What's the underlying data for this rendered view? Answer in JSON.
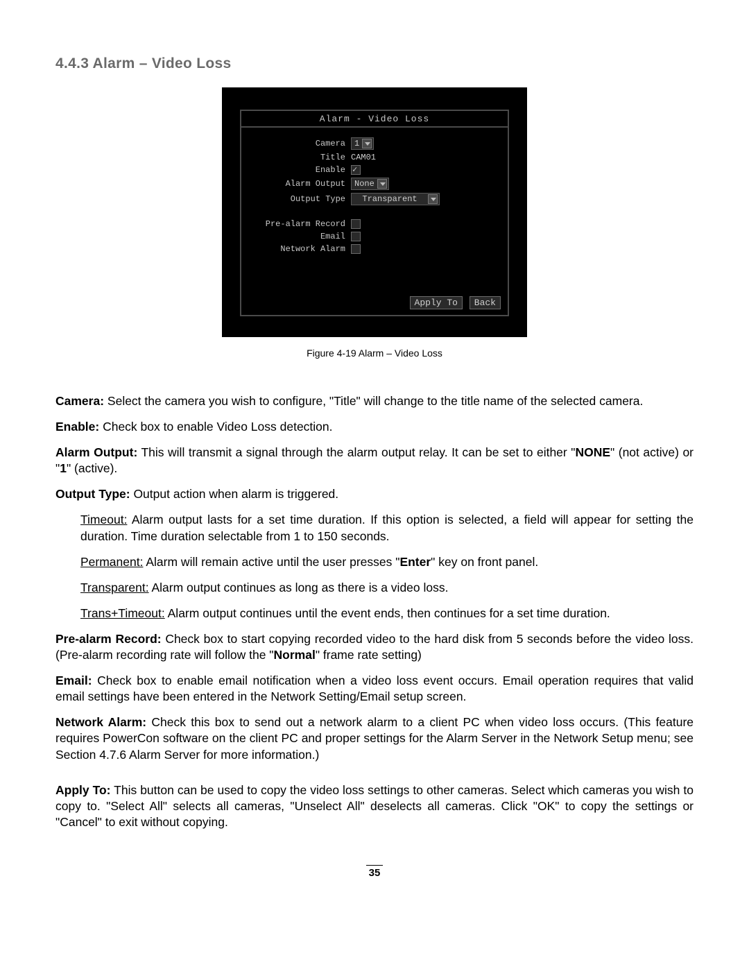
{
  "section_heading": "4.4.3  Alarm – Video Loss",
  "figure": {
    "caption": "Figure 4-19 Alarm – Video Loss",
    "screen": {
      "title": "Alarm - Video Loss",
      "rows": {
        "camera_label": "Camera",
        "camera_value": "1",
        "title_label": "Title",
        "title_value": "CAM01",
        "enable_label": "Enable",
        "alarm_output_label": "Alarm Output",
        "alarm_output_value": "None",
        "output_type_label": "Output Type",
        "output_type_value": "Transparent",
        "prealarm_label": "Pre-alarm Record",
        "email_label": "Email",
        "network_alarm_label": "Network Alarm"
      },
      "footer": {
        "apply_to": "Apply To",
        "back": "Back"
      }
    }
  },
  "body": {
    "camera_label": "Camera:",
    "camera_text": " Select the camera you wish to configure, \"Title\" will change to the title name of the selected camera.",
    "enable_label": "Enable:",
    "enable_text": " Check box to enable Video Loss detection.",
    "alarm_output_label": "Alarm Output:",
    "alarm_output_text_1": " This will transmit a signal through the alarm output relay. It can be set to either \"",
    "alarm_output_none": "NONE",
    "alarm_output_text_2": "\" (not active) or \"",
    "alarm_output_one": "1",
    "alarm_output_text_3": "\" (active).",
    "output_type_label": "Output Type:",
    "output_type_text": " Output action when alarm is triggered.",
    "timeout_label": "Timeout:",
    "timeout_text": " Alarm output lasts for a set time duration. If this option is selected, a field will appear for setting the duration. Time duration selectable from 1 to 150 seconds.",
    "permanent_label": "Permanent:",
    "permanent_text_1": " Alarm will remain active until the user presses \"",
    "permanent_enter": "Enter",
    "permanent_text_2": "\" key on front panel.",
    "transparent_label": "Transparent:",
    "transparent_text": " Alarm output continues as long as there is a video loss.",
    "transtimeout_label": "Trans+Timeout:",
    "transtimeout_text": " Alarm output continues until the event ends, then continues for a set time duration.",
    "prealarm_label": "Pre-alarm Record:",
    "prealarm_text_1": " Check box to start copying recorded video to the hard disk from 5 seconds before the video loss. (Pre-alarm recording rate will follow the \"",
    "prealarm_normal": "Normal",
    "prealarm_text_2": "\" frame rate setting)",
    "email_label": "Email:",
    "email_text": " Check box to enable email notification when a video loss event occurs. Email operation requires that valid email settings have been entered in the Network Setting/Email setup screen.",
    "network_alarm_label": "Network Alarm:",
    "network_alarm_text": " Check this box to send out a network alarm to a client PC when video loss occurs. (This feature requires PowerCon software on the client PC and proper settings for the Alarm Server in the Network Setup menu; see Section 4.7.6 Alarm Server for more information.)",
    "apply_to_label": "Apply To:",
    "apply_to_text": " This button can be used to copy the video loss settings to other cameras. Select which cameras you wish to copy to. \"Select All\" selects all cameras, \"Unselect All\" deselects all cameras. Click \"OK\" to copy the settings or \"Cancel\" to exit without copying."
  },
  "page_number": "35"
}
